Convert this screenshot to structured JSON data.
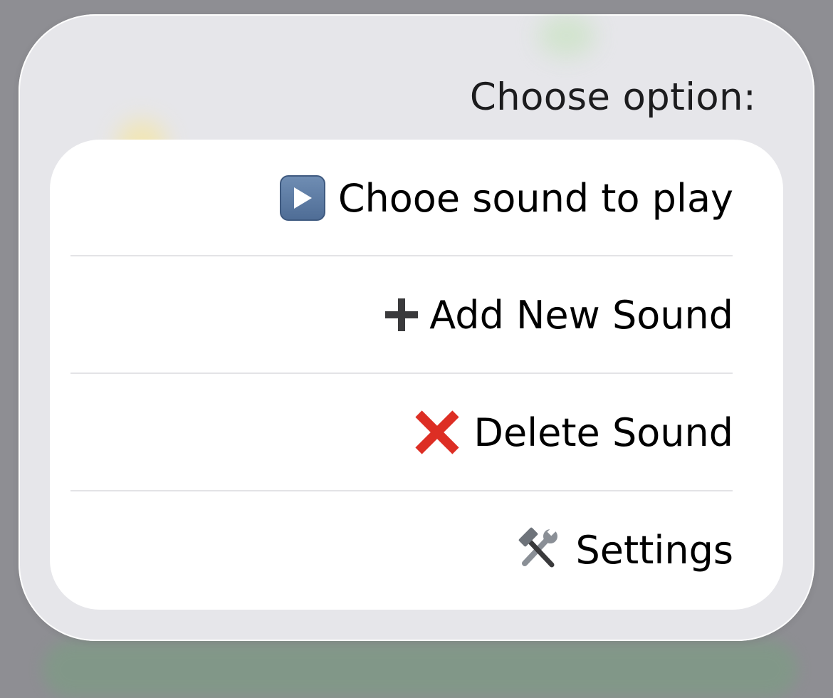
{
  "sheet": {
    "title": "Choose option:"
  },
  "menu": {
    "items": [
      {
        "label": "Chooe sound to play",
        "icon": "play-button-icon"
      },
      {
        "label": "Add New Sound",
        "icon": "plus-icon"
      },
      {
        "label": "Delete Sound",
        "icon": "cross-mark-icon"
      },
      {
        "label": "Settings",
        "icon": "hammer-and-wrench-icon"
      }
    ]
  },
  "colors": {
    "dim_background": "#8e8e93",
    "sheet_background": "#e6e6ea",
    "card_background": "#ffffff",
    "delete_red": "#dd2e24",
    "play_blue": "#5f7fa8"
  }
}
